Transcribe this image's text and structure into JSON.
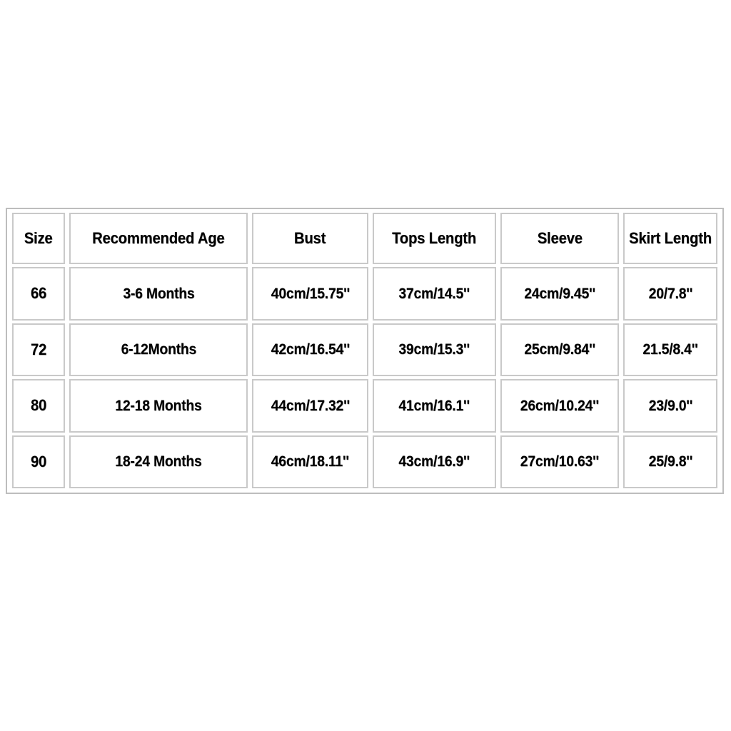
{
  "table": {
    "name": "baby-clothing-size-chart",
    "columns": [
      {
        "key": "size",
        "label": "Size"
      },
      {
        "key": "age",
        "label": "Recommended Age"
      },
      {
        "key": "bust",
        "label": "Bust"
      },
      {
        "key": "tops",
        "label": "Tops Length"
      },
      {
        "key": "sleeve",
        "label": "Sleeve"
      },
      {
        "key": "skirt",
        "label": "Skirt Length"
      }
    ],
    "rows": [
      {
        "size": "66",
        "age": "3-6 Months",
        "bust": "40cm/15.75''",
        "tops": "37cm/14.5''",
        "sleeve": "24cm/9.45''",
        "skirt": "20/7.8''"
      },
      {
        "size": "72",
        "age": "6-12Months",
        "bust": "42cm/16.54''",
        "tops": "39cm/15.3''",
        "sleeve": "25cm/9.84''",
        "skirt": "21.5/8.4''"
      },
      {
        "size": "80",
        "age": "12-18 Months",
        "bust": "44cm/17.32''",
        "tops": "41cm/16.1''",
        "sleeve": "26cm/10.24''",
        "skirt": "23/9.0''"
      },
      {
        "size": "90",
        "age": "18-24 Months",
        "bust": "46cm/18.11''",
        "tops": "43cm/16.9''",
        "sleeve": "27cm/10.63''",
        "skirt": "25/9.8''"
      }
    ]
  },
  "colors": {
    "page_background": "#ffffff",
    "cell_background": "#ffffff",
    "cell_border": "#c9c9c9",
    "table_border": "#bdbdbd",
    "text": "#000000"
  }
}
